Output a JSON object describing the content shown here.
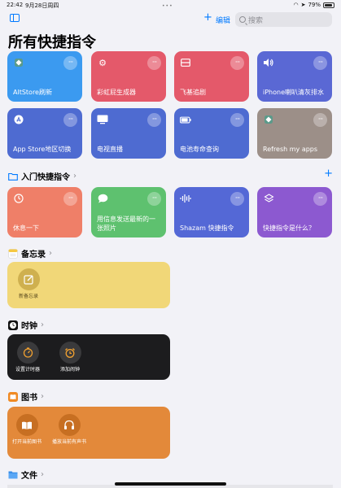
{
  "status": {
    "time": "22:42",
    "date": "9月28日周四",
    "battery": "79%"
  },
  "header": {
    "edit_label": "编辑",
    "search_placeholder": "搜索"
  },
  "page_title": "所有快捷指令",
  "shortcuts": [
    {
      "title": "AltStore刷新",
      "color": "#3b9af0",
      "icon": "altstore-icon"
    },
    {
      "title": "彩虹屁生成器",
      "color": "#e4596a",
      "icon": "gear-icon"
    },
    {
      "title": "飞基追剧",
      "color": "#e4596a",
      "icon": "tv-box-icon"
    },
    {
      "title": "iPhone喇叭清灰排水",
      "color": "#5a68d4",
      "icon": "speaker-icon"
    },
    {
      "title": "App Store地区切换",
      "color": "#4e6bd1",
      "icon": "app-store-icon"
    },
    {
      "title": "电视直播",
      "color": "#4e6bd1",
      "icon": "monitor-icon"
    },
    {
      "title": "电池寿命查询",
      "color": "#4e6bd1",
      "icon": "battery-icon"
    },
    {
      "title": "Refresh my apps",
      "color": "#9c8f88",
      "icon": "altstore-icon"
    }
  ],
  "starter": {
    "heading": "入门快捷指令",
    "items": [
      {
        "title": "休息一下",
        "color": "#ef7f68",
        "icon": "timer-icon"
      },
      {
        "title": "用信息发送最新的一张照片",
        "color": "#5ec16f",
        "icon": "message-icon"
      },
      {
        "title": "Shazam 快捷指令",
        "color": "#5468d6",
        "icon": "waveform-icon"
      },
      {
        "title": "快捷指令是什么？",
        "color": "#8c59d0",
        "icon": "layers-icon"
      }
    ]
  },
  "notes": {
    "heading": "备忘录",
    "items": [
      {
        "label": "新备忘录"
      }
    ]
  },
  "clock": {
    "heading": "时钟",
    "items": [
      {
        "label": "设置计时器"
      },
      {
        "label": "添加闹钟"
      }
    ]
  },
  "books": {
    "heading": "图书",
    "items": [
      {
        "label": "打开当前图书"
      },
      {
        "label": "播放当前有声书"
      }
    ]
  },
  "files": {
    "heading": "文件"
  }
}
